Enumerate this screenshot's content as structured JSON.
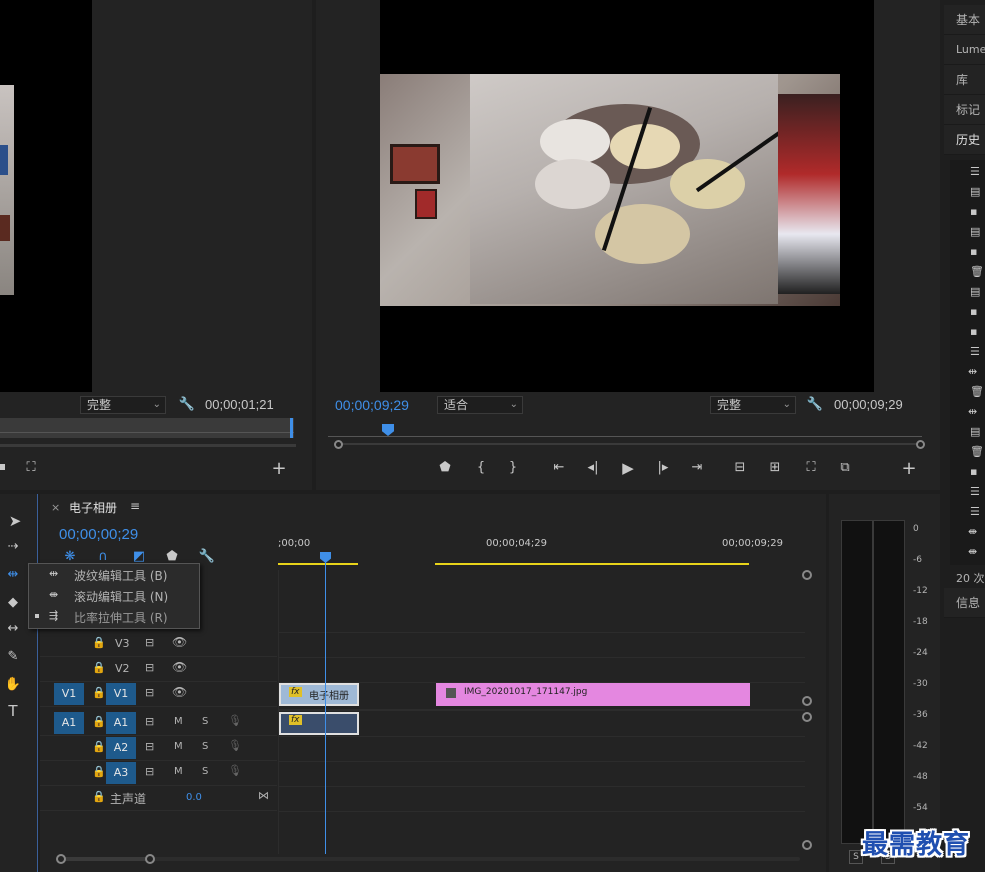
{
  "source_monitor": {
    "quality": "完整",
    "timecode": "00;00;01;21"
  },
  "program_monitor": {
    "timecode": "00;00;09;29",
    "fit": "适合",
    "quality": "完整",
    "duration": "00;00;09;29"
  },
  "program_controls": [
    "marker-icon",
    "mark-in-icon",
    "mark-out-icon",
    "go-to-in-icon",
    "step-back-icon",
    "play-icon",
    "step-forward-icon",
    "go-to-out-icon",
    "lift-icon",
    "extract-icon",
    "camera-icon",
    "compare-icon",
    "plus-icon"
  ],
  "right_tabs": [
    "基本",
    "Lume",
    "库",
    "标记",
    "历史"
  ],
  "history_footer": "20 次",
  "info_tab": "信息",
  "timeline": {
    "sequence_name": "电子相册",
    "timecode": "00;00;00;29",
    "ruler_labels": [
      ";00;00",
      "00;00;04;29",
      "00;00;09;29"
    ],
    "tracks_video": [
      {
        "name": "V3"
      },
      {
        "name": "V2"
      },
      {
        "name": "V1",
        "source": "V1"
      }
    ],
    "tracks_audio": [
      {
        "name": "A1",
        "source": "A1"
      },
      {
        "name": "A2"
      },
      {
        "name": "A3"
      }
    ],
    "master": {
      "label": "主声道",
      "value": "0.0"
    },
    "clips": {
      "v1_clip1": "电子相册",
      "v1_clip2": "IMG_20201017_171147.jpg",
      "fx": "fx"
    },
    "m_label": "M",
    "s_label": "S"
  },
  "tool_menu": {
    "items": [
      {
        "label": "波纹编辑工具 (B)"
      },
      {
        "label": "滚动编辑工具 (N)"
      },
      {
        "label": "比率拉伸工具 (R)"
      }
    ]
  },
  "meter": {
    "labels": [
      "0",
      "-6",
      "-12",
      "-18",
      "-24",
      "-30",
      "-36",
      "-42",
      "-48",
      "-54"
    ],
    "solo": "S"
  },
  "watermark": "最需教育"
}
